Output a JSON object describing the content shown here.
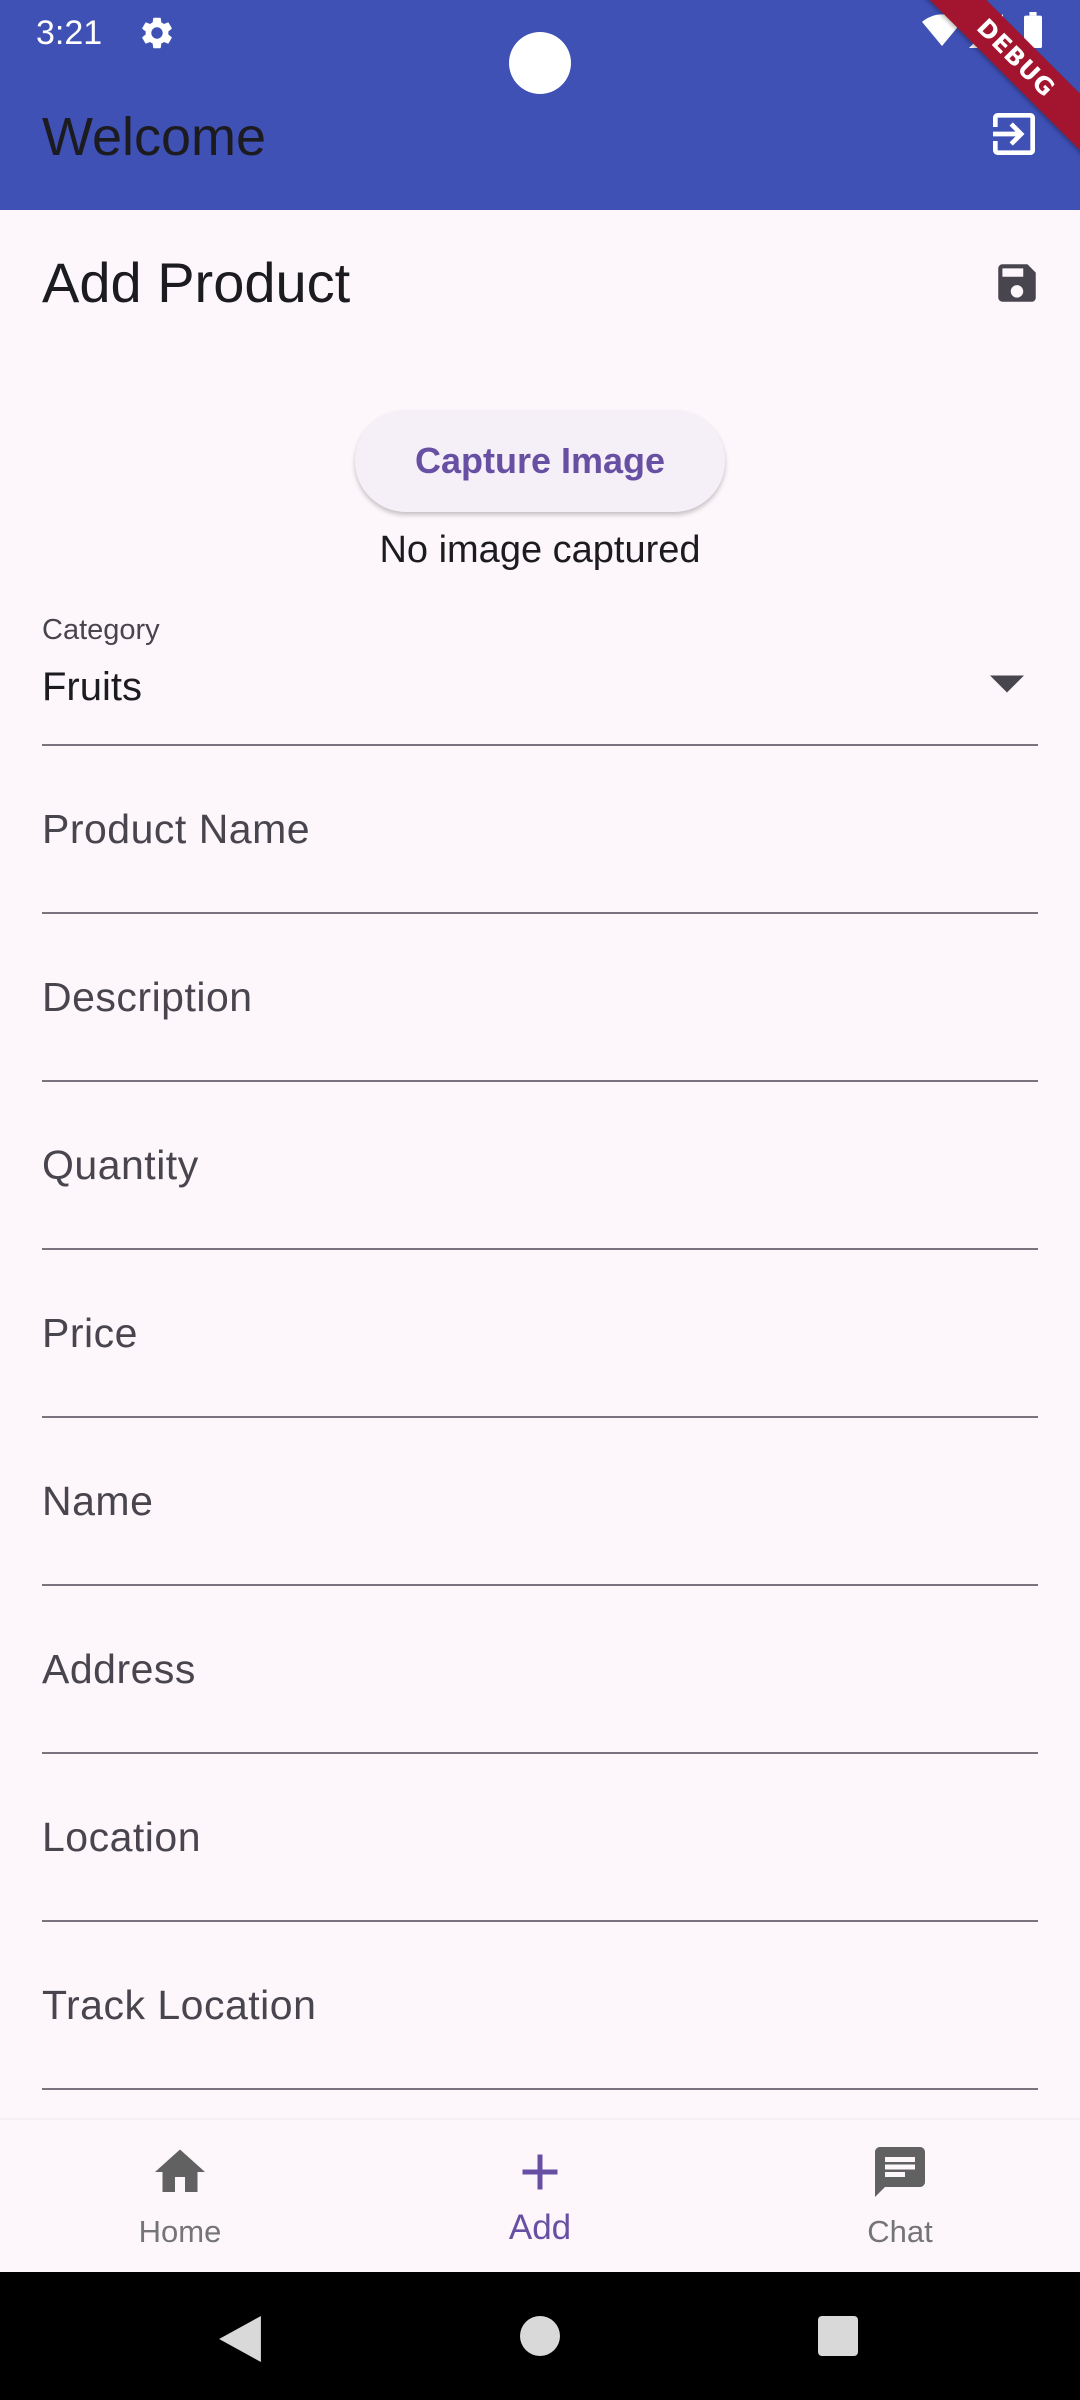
{
  "status_bar": {
    "time": "3:21"
  },
  "app_bar": {
    "title": "Welcome",
    "debug_banner": "DEBUG",
    "background_color": "#3f51b5"
  },
  "page": {
    "title": "Add Product"
  },
  "capture": {
    "button_label": "Capture Image",
    "status_text": "No image captured"
  },
  "category": {
    "label": "Category",
    "selected": "Fruits"
  },
  "fields": [
    {
      "label": "Product Name"
    },
    {
      "label": "Description"
    },
    {
      "label": "Quantity"
    },
    {
      "label": "Price"
    },
    {
      "label": "Name"
    },
    {
      "label": "Address"
    },
    {
      "label": "Location"
    },
    {
      "label": "Track Location"
    }
  ],
  "bottom_nav": {
    "items": [
      {
        "label": "Home",
        "icon": "home-icon"
      },
      {
        "label": "Add",
        "icon": "add-icon",
        "active": true
      },
      {
        "label": "Chat",
        "icon": "chat-icon"
      }
    ]
  },
  "colors": {
    "accent": "#6750a4",
    "page_background": "#fdf7fc"
  }
}
